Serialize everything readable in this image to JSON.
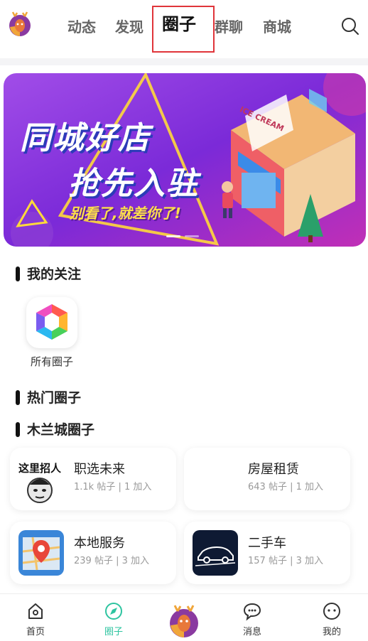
{
  "header": {
    "tabs": [
      {
        "label": "动态"
      },
      {
        "label": "发现"
      },
      {
        "label": "圈子"
      },
      {
        "label": "群聊"
      },
      {
        "label": "商城"
      }
    ],
    "active_tab": "圈子",
    "icons": [
      "deer-logo",
      "search-icon"
    ]
  },
  "banner": {
    "line1": "同城好店",
    "line2": "抢先入驻",
    "line3": "别看了,就差你了!",
    "shop_sign": "ICE CREAM",
    "page_dots": 2
  },
  "sections": {
    "following_title": "我的关注",
    "hot_title": "热门圈子",
    "local_title": "木兰城圈子"
  },
  "following": [
    {
      "label": "所有圈子",
      "icon": "hexagon-colorful-icon"
    }
  ],
  "circles": [
    {
      "name": "职选未来",
      "stats": "1.1k 帖子 | 1 加入",
      "thumb_text": "这里招人"
    },
    {
      "name": "房屋租赁",
      "stats": "643 帖子 | 1 加入"
    },
    {
      "name": "本地服务",
      "stats": "239 帖子 | 3 加入",
      "thumb_icon": "map-pin-icon"
    },
    {
      "name": "二手车",
      "stats": "157 帖子 | 3 加入",
      "thumb_icon": "car-icon"
    }
  ],
  "bottom_nav": [
    {
      "label": "首页",
      "icon": "home-icon"
    },
    {
      "label": "圈子",
      "icon": "compass-icon",
      "active": true
    },
    {
      "label": "",
      "icon": "deer-logo"
    },
    {
      "label": "消息",
      "icon": "message-icon"
    },
    {
      "label": "我的",
      "icon": "face-icon"
    }
  ],
  "colors": {
    "accent": "#2ec4a0",
    "highlight_box": "#e0353a",
    "banner_purple": "#7a2cd6"
  }
}
